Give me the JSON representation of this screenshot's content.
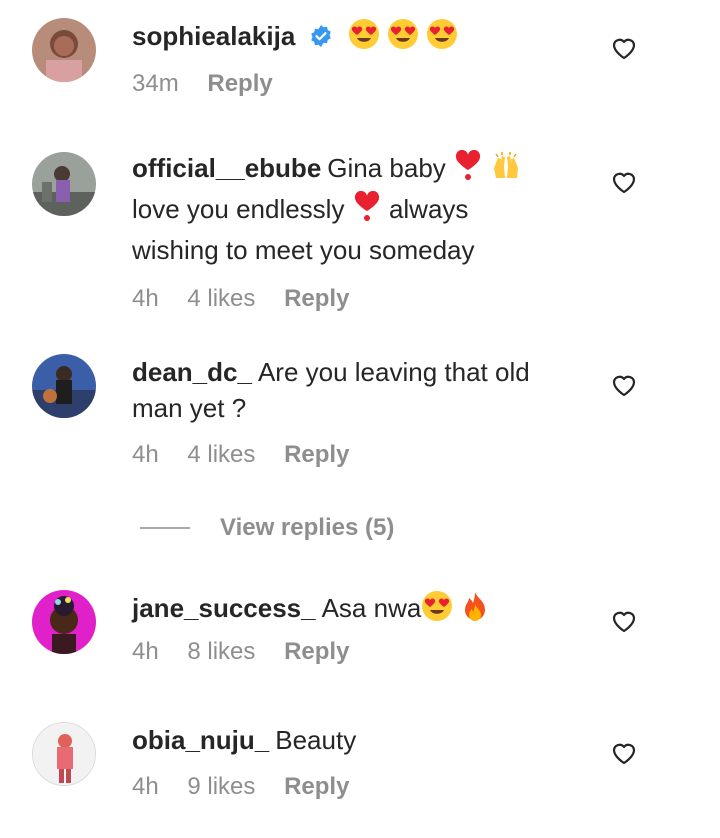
{
  "comments": [
    {
      "username": "sophiealakija",
      "verified": true,
      "text": "",
      "emojis": [
        "heart-eyes",
        "heart-eyes",
        "heart-eyes"
      ],
      "time": "34m",
      "likes": "",
      "reply_label": "Reply"
    },
    {
      "username": "official__ebube",
      "text_line1": "Gina baby",
      "text_line2": "love you endlessly",
      "text_line2b": "always",
      "text_line3": "wishing to meet you someday",
      "time": "4h",
      "likes": "4 likes",
      "reply_label": "Reply"
    },
    {
      "username": "dean_dc_",
      "text_line1": "Are you leaving that old",
      "text_line2": "man yet ?",
      "time": "4h",
      "likes": "4 likes",
      "reply_label": "Reply"
    },
    {
      "username": "jane_success_",
      "text": "Asa nwa",
      "time": "4h",
      "likes": "8 likes",
      "reply_label": "Reply"
    },
    {
      "username": "obia_nuju_",
      "text": "Beauty",
      "time": "4h",
      "likes": "9 likes",
      "reply_label": "Reply"
    }
  ],
  "view_replies_label": "View replies (5)",
  "colors": {
    "text": "#262626",
    "meta": "#8e8e8e",
    "verified": "#3897f0",
    "heart_emoji": "#e8202f"
  }
}
